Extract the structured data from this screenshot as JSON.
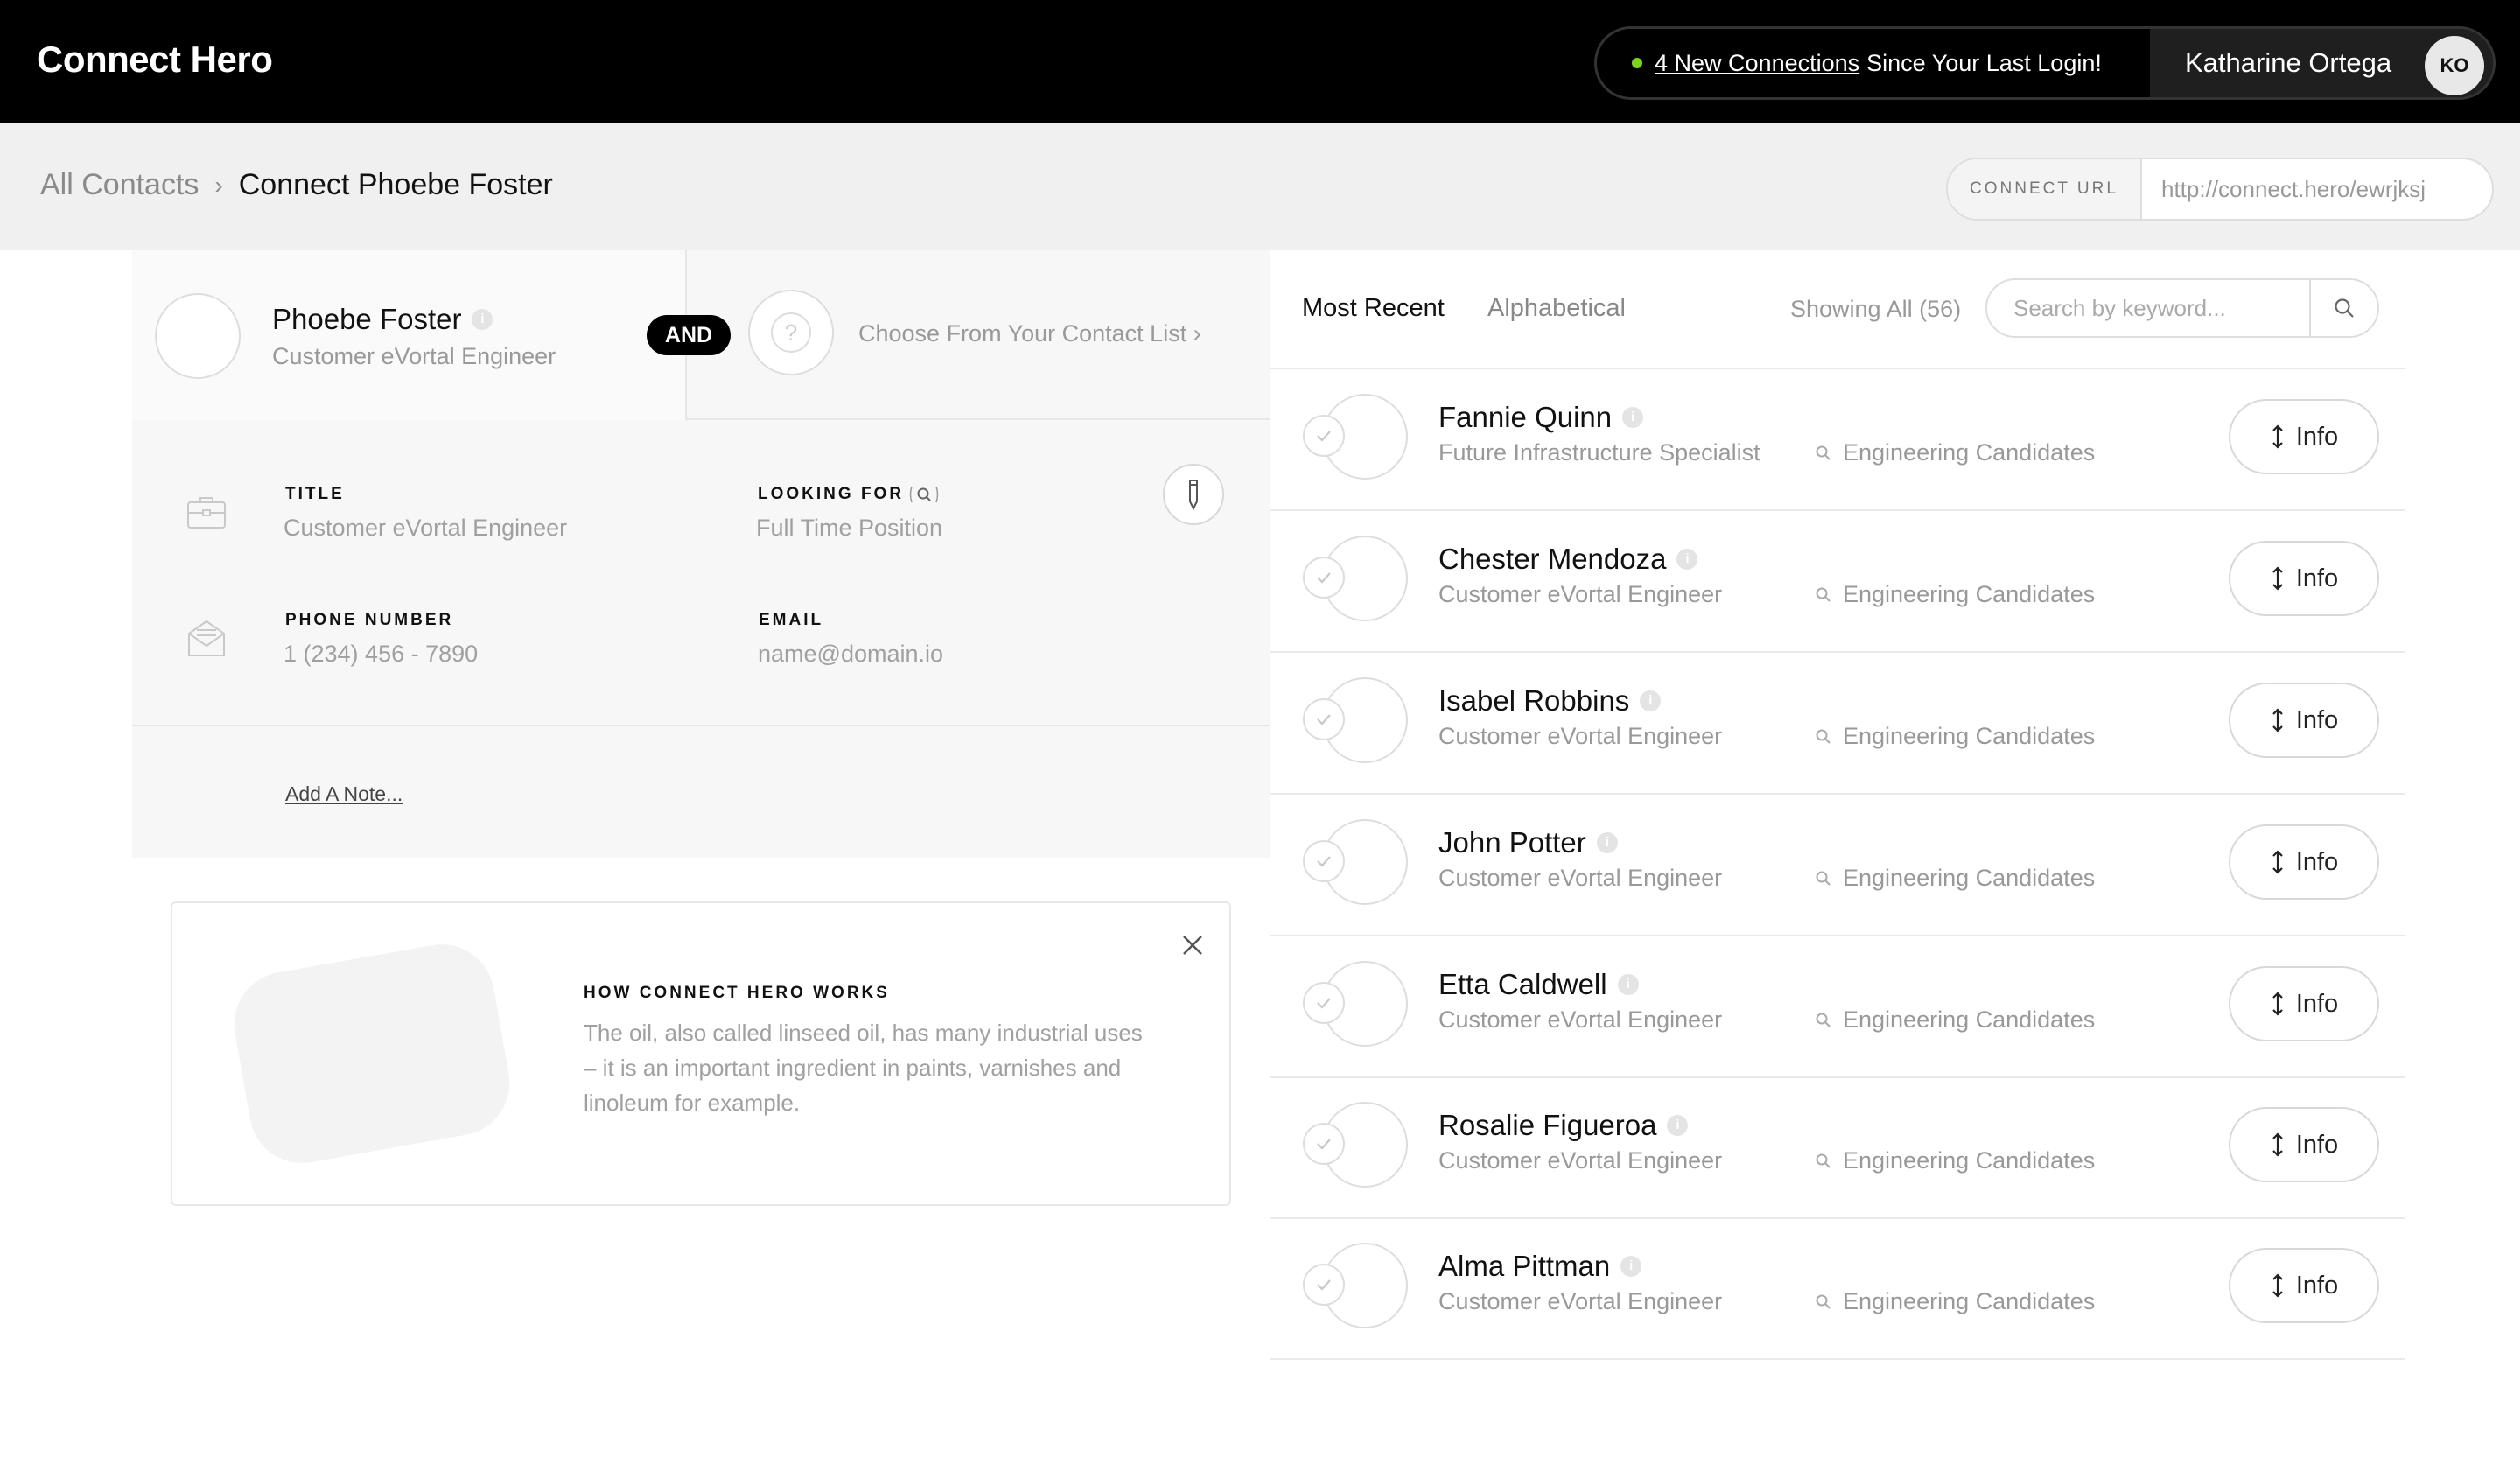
{
  "header": {
    "brand": "Connect Hero",
    "notice_link": "4 New Connections",
    "notice_rest": "Since Your Last Login!",
    "user_name": "Katharine Ortega",
    "user_initials": "KO"
  },
  "breadcrumb": {
    "root": "All Contacts",
    "separator": "›",
    "current": "Connect Phoebe Foster"
  },
  "connect_url": {
    "label": "CONNECT URL",
    "value": "http://connect.hero/ewrjksj"
  },
  "pair": {
    "name": "Phoebe Foster",
    "title": "Customer eVortal Engineer",
    "and_label": "AND",
    "choose_label": "Choose From Your Contact List ›"
  },
  "details": {
    "title_label": "TITLE",
    "title_value": "Customer eVortal Engineer",
    "looking_label": "LOOKING FOR",
    "looking_value": "Full Time Position",
    "phone_label": "PHONE NUMBER",
    "phone_value": "1 (234) 456 - 7890",
    "email_label": "EMAIL",
    "email_value": "name@domain.io",
    "note_link": "Add A Note..."
  },
  "how_it_works": {
    "title": "HOW CONNECT HERO WORKS",
    "text": "The oil, also called linseed oil, has many industrial uses – it is an important ingredient in paints, varnishes and linoleum for example."
  },
  "list": {
    "tabs": [
      "Most Recent",
      "Alphabetical"
    ],
    "active_tab": "Most Recent",
    "showing": "Showing All (56)",
    "search_placeholder": "Search by keyword...",
    "info_label": "Info",
    "contacts": [
      {
        "name": "Fannie Quinn",
        "title": "Future Infrastructure Specialist",
        "group": "Engineering Candidates"
      },
      {
        "name": "Chester Mendoza",
        "title": "Customer eVortal Engineer",
        "group": "Engineering Candidates"
      },
      {
        "name": "Isabel Robbins",
        "title": "Customer eVortal Engineer",
        "group": "Engineering Candidates"
      },
      {
        "name": "John Potter",
        "title": "Customer eVortal Engineer",
        "group": "Engineering Candidates"
      },
      {
        "name": "Etta Caldwell",
        "title": "Customer eVortal Engineer",
        "group": "Engineering Candidates"
      },
      {
        "name": "Rosalie Figueroa",
        "title": "Customer eVortal Engineer",
        "group": "Engineering Candidates"
      },
      {
        "name": "Alma Pittman",
        "title": "Customer eVortal Engineer",
        "group": "Engineering Candidates"
      }
    ]
  },
  "icons": {
    "info": "info-icon",
    "check": "check-icon",
    "search": "search-icon",
    "expand": "expand-arrows-icon",
    "briefcase": "briefcase-icon",
    "envelope": "envelope-icon",
    "pen": "pen-icon",
    "close": "close-icon"
  },
  "colors": {
    "header_bg": "#000000",
    "online_dot": "#7ed321",
    "subbar_bg": "#f0f0f0"
  }
}
